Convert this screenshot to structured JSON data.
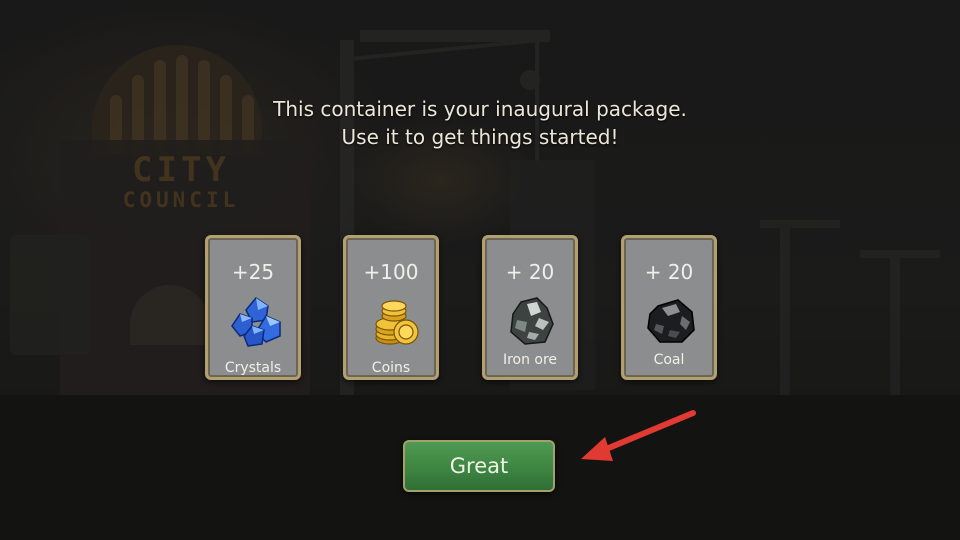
{
  "background": {
    "sign_line1": "CITY",
    "sign_line2": "COUNCIL"
  },
  "dialog": {
    "message_line1": "This container is your inaugural package.",
    "message_line2": "Use it to get things started!"
  },
  "rewards": [
    {
      "amount": "+25",
      "label": "Crystals",
      "icon": "crystals-icon"
    },
    {
      "amount": "+100",
      "label": "Coins",
      "icon": "coins-icon"
    },
    {
      "amount": "+ 20",
      "label": "Iron ore",
      "icon": "iron-ore-icon"
    },
    {
      "amount": "+ 20",
      "label": "Coal",
      "icon": "coal-icon"
    }
  ],
  "confirm_button": {
    "label": "Great"
  },
  "colors": {
    "button_green": "#3e8542",
    "card_border": "#b3a071",
    "arrow_red": "#e03a33"
  }
}
